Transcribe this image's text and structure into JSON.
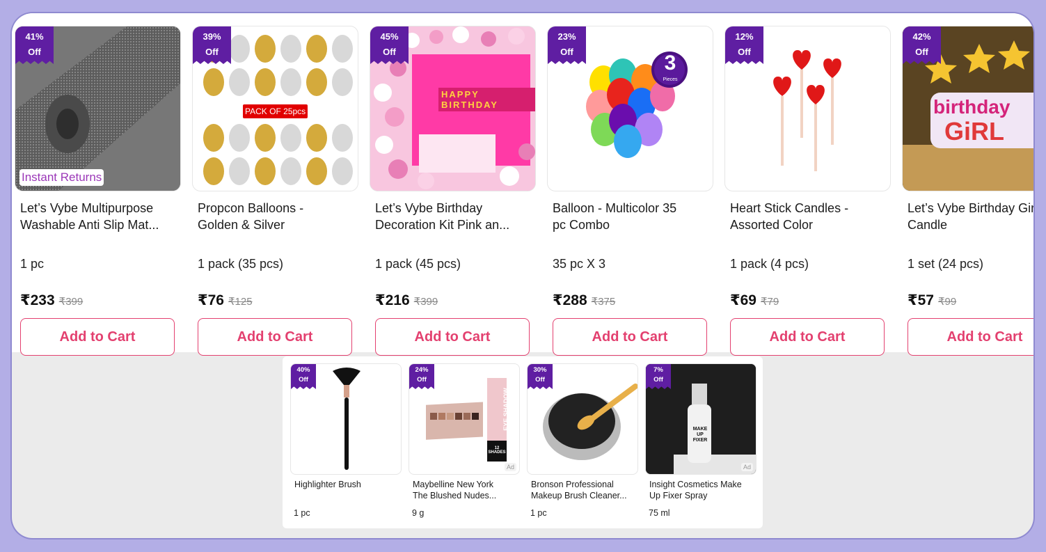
{
  "products": [
    {
      "discount_pct": "41%",
      "off": "Off",
      "title_line1": "Let’s Vybe Multipurpose",
      "title_line2": "Washable Anti Slip Mat...",
      "qty": "1 pc",
      "price": "₹233",
      "mrp": "₹399",
      "cta": "Add to Cart",
      "overlay": "Instant Returns"
    },
    {
      "discount_pct": "39%",
      "off": "Off",
      "title_line1": "Propcon Balloons -",
      "title_line2": "Golden & Silver",
      "qty": "1 pack (35 pcs)",
      "price": "₹76",
      "mrp": "₹125",
      "cta": "Add to Cart",
      "overlay": "PACK OF 25pcs"
    },
    {
      "discount_pct": "45%",
      "off": "Off",
      "title_line1": "Let’s Vybe Birthday",
      "title_line2": "Decoration Kit Pink an...",
      "qty": "1 pack (45 pcs)",
      "price": "₹216",
      "mrp": "₹399",
      "cta": "Add to Cart",
      "overlay": "HAPPY BIRTHDAY"
    },
    {
      "discount_pct": "23%",
      "off": "Off",
      "title_line1": "Balloon - Multicolor 35",
      "title_line2": "pc Combo",
      "qty": "35 pc X 3",
      "price": "₹288",
      "mrp": "₹375",
      "cta": "Add to Cart",
      "overlay": "3",
      "overlay_sub": "Pieces"
    },
    {
      "discount_pct": "12%",
      "off": "Off",
      "title_line1": "Heart Stick Candles -",
      "title_line2": "Assorted Color",
      "qty": "1 pack (4 pcs)",
      "price": "₹69",
      "mrp": "₹79",
      "cta": "Add to Cart"
    },
    {
      "discount_pct": "42%",
      "off": "Off",
      "title_line1": "Let’s Vybe Birthday Girl",
      "title_line2": "Candle",
      "qty": "1 set (24 pcs)",
      "price": "₹57",
      "mrp": "₹99",
      "cta": "Add to Cart",
      "overlay": "birthday",
      "overlay2": "GiRL"
    }
  ],
  "ads": [
    {
      "discount_pct": "40%",
      "off": "Off",
      "title_line1": "Highlighter Brush",
      "title_line2": "",
      "qty": "1 pc"
    },
    {
      "discount_pct": "24%",
      "off": "Off",
      "title_line1": "Maybelline New York",
      "title_line2": "The Blushed Nudes...",
      "qty": "9 g",
      "ad": "Ad",
      "pack_text": "EYE SHADOW",
      "pack_shades": "12 SHADES"
    },
    {
      "discount_pct": "30%",
      "off": "Off",
      "title_line1": "Bronson Professional",
      "title_line2": "Makeup Brush Cleaner...",
      "qty": "1 pc"
    },
    {
      "discount_pct": "7%",
      "off": "Off",
      "title_line1": "Insight Cosmetics Make",
      "title_line2": "Up Fixer Spray",
      "qty": "75 ml",
      "ad": "Ad",
      "bottle_text": "MAKE UP FIXER"
    }
  ],
  "colors": {
    "badge": "#5f1ea2",
    "cta": "#e3406f",
    "frame": "#b3aee6"
  }
}
